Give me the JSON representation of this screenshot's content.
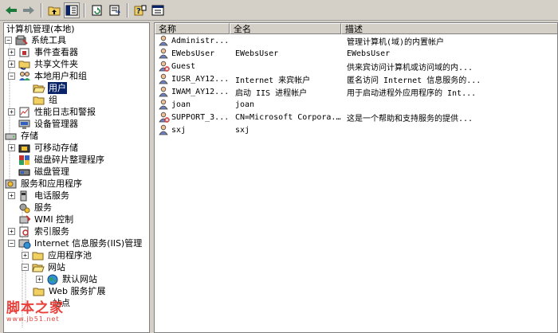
{
  "toolbar": {
    "buttons": [
      "back-icon",
      "forward-icon",
      "up-folder-icon",
      "show-tree-icon",
      "refresh-icon",
      "export-list-icon",
      "help-icon",
      "properties-icon"
    ]
  },
  "tree": {
    "items": [
      {
        "label": "计算机管理(本地)"
      },
      {
        "label": "系统工具"
      },
      {
        "label": "事件查看器"
      },
      {
        "label": "共享文件夹"
      },
      {
        "label": "本地用户和组"
      },
      {
        "label": "用户"
      },
      {
        "label": "组"
      },
      {
        "label": "性能日志和警报"
      },
      {
        "label": "设备管理器"
      },
      {
        "label": "存储"
      },
      {
        "label": "可移动存储"
      },
      {
        "label": "磁盘碎片整理程序"
      },
      {
        "label": "磁盘管理"
      },
      {
        "label": "服务和应用程序"
      },
      {
        "label": "电话服务"
      },
      {
        "label": "服务"
      },
      {
        "label": "WMI 控制"
      },
      {
        "label": "索引服务"
      },
      {
        "label": "Internet 信息服务(IIS)管理"
      },
      {
        "label": "应用程序池"
      },
      {
        "label": "网站"
      },
      {
        "label": "默认网站"
      },
      {
        "label": "Web 服务扩展"
      },
      {
        "label": "站点"
      }
    ]
  },
  "list": {
    "columns": [
      "名称",
      "全名",
      "描述"
    ],
    "rows": [
      {
        "name": "Administr...",
        "full": "",
        "desc": "管理计算机(域)的内置帐户",
        "disabled": false
      },
      {
        "name": "EWebsUser",
        "full": "EWebsUser",
        "desc": "EWebsUser",
        "disabled": false
      },
      {
        "name": "Guest",
        "full": "",
        "desc": "供来宾访问计算机或访问域的内...",
        "disabled": true
      },
      {
        "name": "IUSR_AY12...",
        "full": "Internet 来宾帐户",
        "desc": "匿名访问 Internet 信息服务的...",
        "disabled": false
      },
      {
        "name": "IWAM_AY12...",
        "full": "启动 IIS 进程帐户",
        "desc": "用于启动进程外应用程序的 Int...",
        "disabled": false
      },
      {
        "name": "joan",
        "full": "joan",
        "desc": "",
        "disabled": false
      },
      {
        "name": "SUPPORT_3...",
        "full": "CN=Microsoft Corpora...",
        "desc": "这是一个帮助和支持服务的提供...",
        "disabled": true
      },
      {
        "name": "sxj",
        "full": "sxj",
        "desc": "",
        "disabled": false
      }
    ]
  },
  "watermark": {
    "main": "脚本之家",
    "sub": "www.jb51.net"
  },
  "colors": {
    "selection": "#0a246a",
    "chrome": "#d4d0c8",
    "watermark": "#e8403a"
  }
}
